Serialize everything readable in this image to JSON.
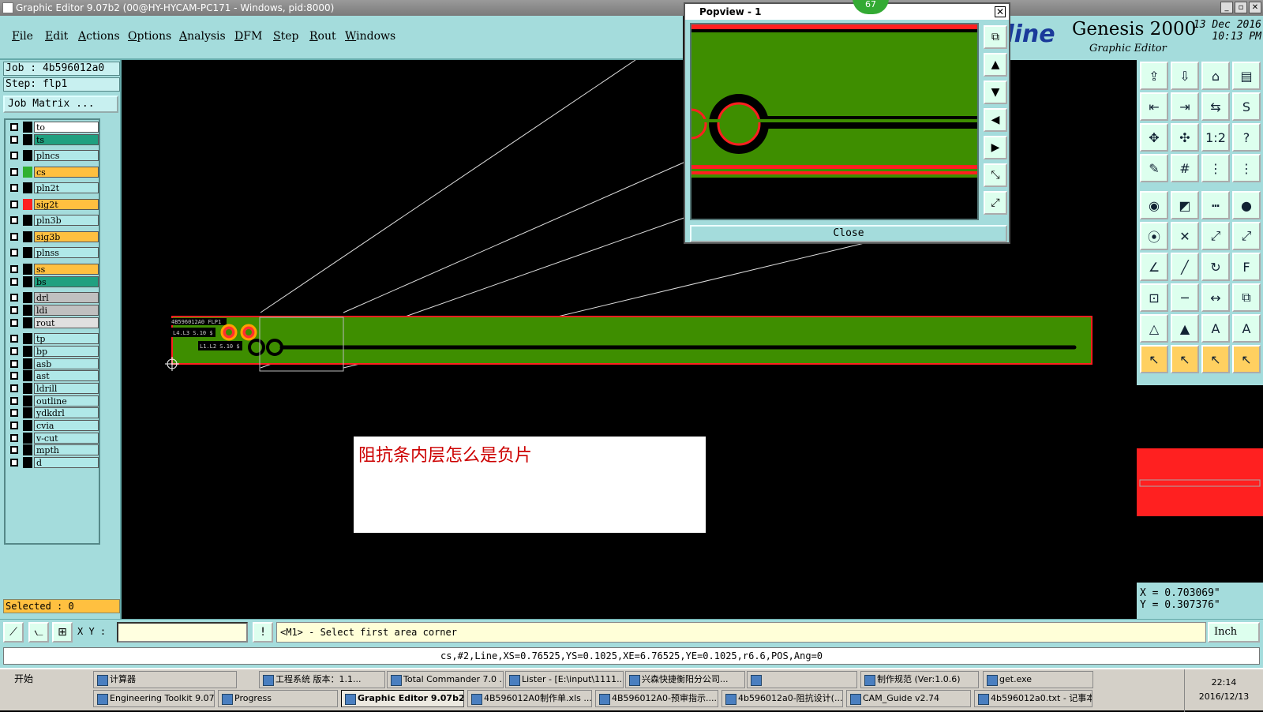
{
  "window": {
    "title": "Graphic Editor 9.07b2 (00@HY-HYCAM-PC171 - Windows, pid:8000)"
  },
  "menu": [
    "File",
    "Edit",
    "Actions",
    "Options",
    "Analysis",
    "DFM",
    "Step",
    "Rout",
    "Windows"
  ],
  "brand": {
    "logo": "tline",
    "name": "Genesis 2000",
    "subtitle": "Graphic Editor",
    "date": "13 Dec 2016",
    "time": "10:13 PM"
  },
  "job": {
    "job_label": "Job : 4b596012a0",
    "step_label": "Step: flp1",
    "matrix_button": "Job Matrix ..."
  },
  "layers": [
    {
      "name": "to",
      "color": "#ffffff",
      "swatch": "#000000"
    },
    {
      "name": "ts",
      "color": "#20a080",
      "swatch": "#000000"
    },
    {
      "name": "plncs",
      "color": "#b0e8e8",
      "swatch": "#000000"
    },
    {
      "name": "cs",
      "color": "#ffc040",
      "swatch": "#30b030"
    },
    {
      "name": "pln2t",
      "color": "#b0e8e8",
      "swatch": "#000000"
    },
    {
      "name": "sig2t",
      "color": "#ffc040",
      "swatch": "#ff2020"
    },
    {
      "name": "pln3b",
      "color": "#b0e8e8",
      "swatch": "#000000"
    },
    {
      "name": "sig3b",
      "color": "#ffc040",
      "swatch": "#000000"
    },
    {
      "name": "plnss",
      "color": "#b0e8e8",
      "swatch": "#000000"
    },
    {
      "name": "ss",
      "color": "#ffc040",
      "swatch": "#000000"
    },
    {
      "name": "bs",
      "color": "#20a080",
      "swatch": "#000000"
    },
    {
      "name": "drl",
      "color": "#c0c0c0",
      "swatch": "#000000"
    },
    {
      "name": "ldi",
      "color": "#c0c0c0",
      "swatch": "#000000"
    },
    {
      "name": "rout",
      "color": "#e0e0e0",
      "swatch": "#000000"
    },
    {
      "name": "tp",
      "color": "#b0e8e8",
      "swatch": "#000000"
    },
    {
      "name": "bp",
      "color": "#b0e8e8",
      "swatch": "#000000"
    },
    {
      "name": "asb",
      "color": "#b0e8e8",
      "swatch": "#000000"
    },
    {
      "name": "ast",
      "color": "#b0e8e8",
      "swatch": "#000000"
    },
    {
      "name": "ldrill",
      "color": "#b0e8e8",
      "swatch": "#000000"
    },
    {
      "name": "outline",
      "color": "#b0e8e8",
      "swatch": "#000000"
    },
    {
      "name": "ydkdrl",
      "color": "#b0e8e8",
      "swatch": "#000000"
    },
    {
      "name": "cvia",
      "color": "#b0e8e8",
      "swatch": "#000000"
    },
    {
      "name": "v-cut",
      "color": "#b0e8e8",
      "swatch": "#000000"
    },
    {
      "name": "mpth",
      "color": "#b0e8e8",
      "swatch": "#000000"
    },
    {
      "name": "d",
      "color": "#b0e8e8",
      "swatch": "#000000"
    }
  ],
  "selected_label": "Selected : 0",
  "popview": {
    "title": "Popview - 1",
    "close_label": "Close",
    "badge": "67"
  },
  "canvas": {
    "board_text_1": "4B596012A0 FLP1",
    "board_text_2": "L4.L3 S.10 $",
    "board_text_3": "L1.L2 S.10 $"
  },
  "note": "阻抗条内层怎么是负片",
  "coords": {
    "x": "X = 0.703069\"",
    "y": "Y = 0.307376\""
  },
  "cmd": {
    "xy_label": "X Y :",
    "prompt": "<M1> - Select first area corner",
    "unit": "Inch"
  },
  "info": "cs,#2,Line,XS=0.76525,YS=0.1025,XE=6.76525,YE=0.1025,r6.6,POS,Ang=0",
  "taskbar": {
    "start": "开始",
    "row1": [
      "计算器",
      "工程系统  版本：1.1...",
      "Total Commander 7.0 ...",
      "Lister - [E:\\input\\1111...",
      "兴森快捷衡阳分公司...",
      "",
      "制作规范 (Ver:1.0.6)",
      "get.exe"
    ],
    "row2": [
      "Engineering Toolkit 9.07...",
      "Progress",
      "Graphic Editor 9.07b2...",
      "4B596012A0制作单.xls ...",
      "4B596012A0-预审指示....",
      "4b596012a0-阻抗设计(...",
      "CAM_Guide v2.74",
      "4b596012a0.txt - 记事本"
    ],
    "time": "22:14",
    "date": "2016/12/13"
  }
}
